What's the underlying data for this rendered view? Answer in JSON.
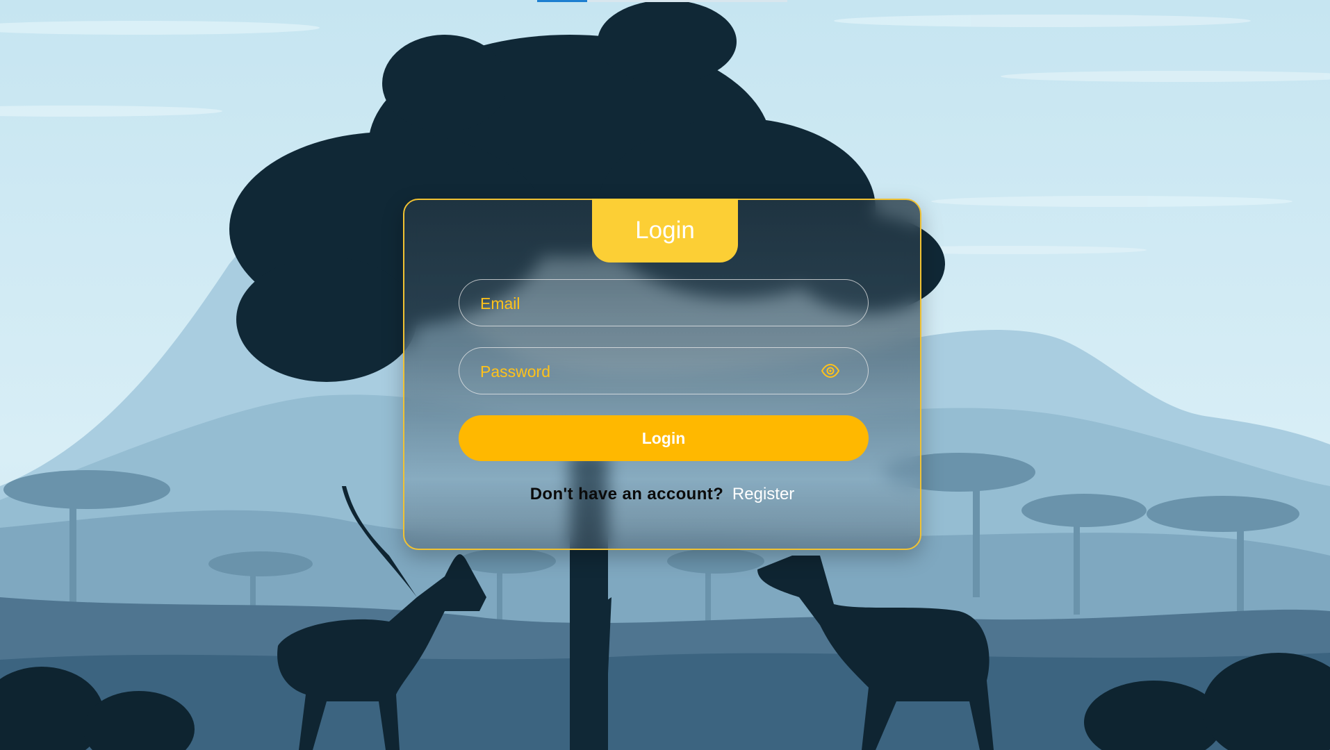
{
  "colors": {
    "accent": "#fccf35",
    "button": "#ffb800",
    "placeholder": "#ffc21a",
    "silhouette": "#102836"
  },
  "login_form": {
    "title": "Login",
    "email_placeholder": "Email",
    "password_placeholder": "Password",
    "toggle_icon": "eye-icon",
    "submit_label": "Login",
    "register_prompt": "Don't have an account?",
    "register_link": "Register"
  }
}
